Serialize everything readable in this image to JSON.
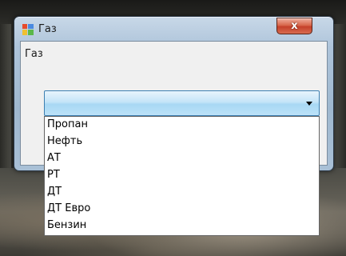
{
  "window": {
    "title": "Газ",
    "close_label": "x"
  },
  "form": {
    "label": "Газ",
    "combo_value": ""
  },
  "dropdown": {
    "items": [
      "Пропан",
      "Нефть",
      "АТ",
      "РТ",
      "ДТ",
      "ДТ Евро",
      "Бензин"
    ]
  },
  "colors": {
    "accent": "#3c7fb1",
    "close_button": "#c4402a"
  }
}
